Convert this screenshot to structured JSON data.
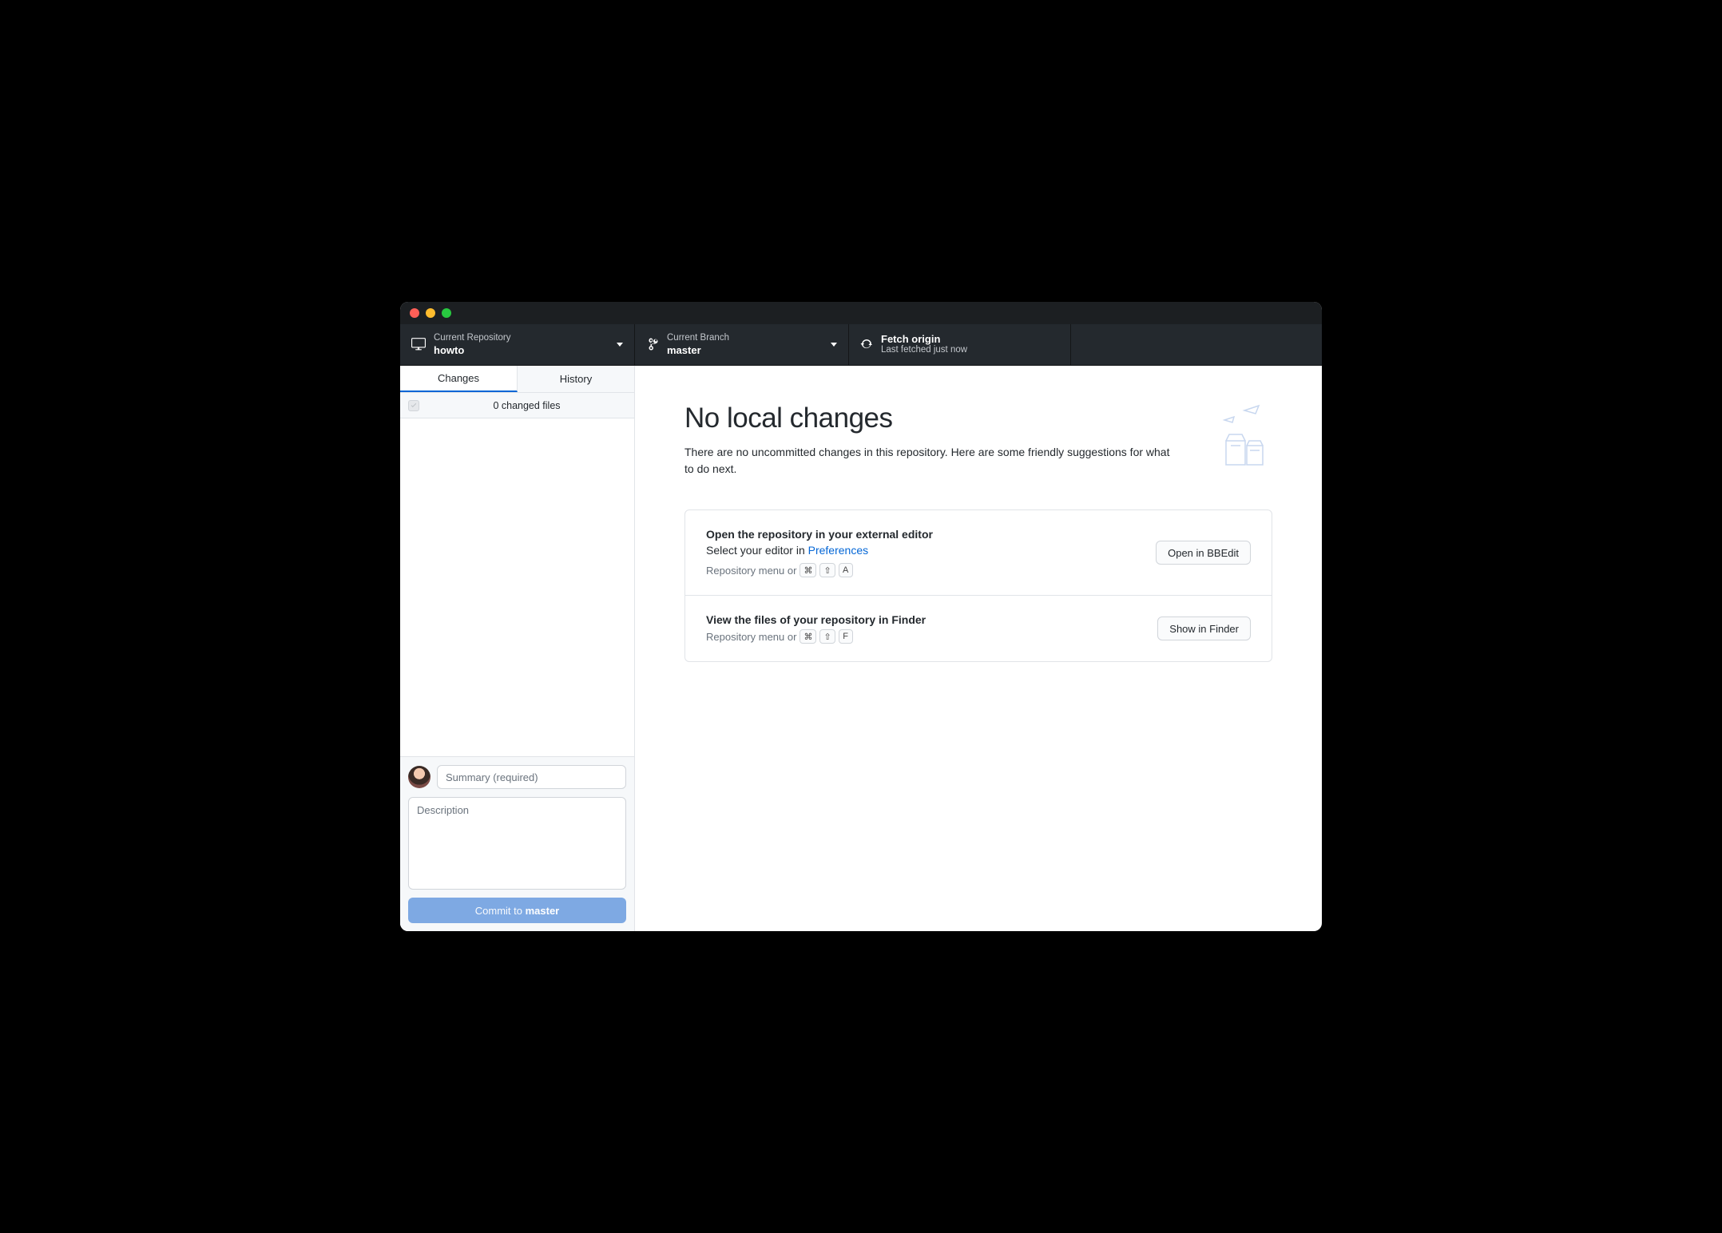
{
  "toolbar": {
    "repo": {
      "label": "Current Repository",
      "value": "howto"
    },
    "branch": {
      "label": "Current Branch",
      "value": "master"
    },
    "fetch": {
      "label": "Fetch origin",
      "value": "Last fetched just now"
    }
  },
  "tabs": {
    "changes": "Changes",
    "history": "History",
    "active": "changes"
  },
  "changes": {
    "count_text": "0 changed files"
  },
  "commit": {
    "summary_placeholder": "Summary (required)",
    "description_placeholder": "Description",
    "button_prefix": "Commit to ",
    "button_branch": "master"
  },
  "main": {
    "title": "No local changes",
    "subtitle": "There are no uncommitted changes in this repository. Here are some friendly suggestions for what to do next.",
    "cards": [
      {
        "title": "Open the repository in your external editor",
        "sub_prefix": "Select your editor in ",
        "sub_link": "Preferences",
        "hint_prefix": "Repository menu or",
        "keys": [
          "⌘",
          "⇧",
          "A"
        ],
        "button": "Open in BBEdit"
      },
      {
        "title": "View the files of your repository in Finder",
        "sub_prefix": "",
        "sub_link": "",
        "hint_prefix": "Repository menu or",
        "keys": [
          "⌘",
          "⇧",
          "F"
        ],
        "button": "Show in Finder"
      }
    ]
  }
}
